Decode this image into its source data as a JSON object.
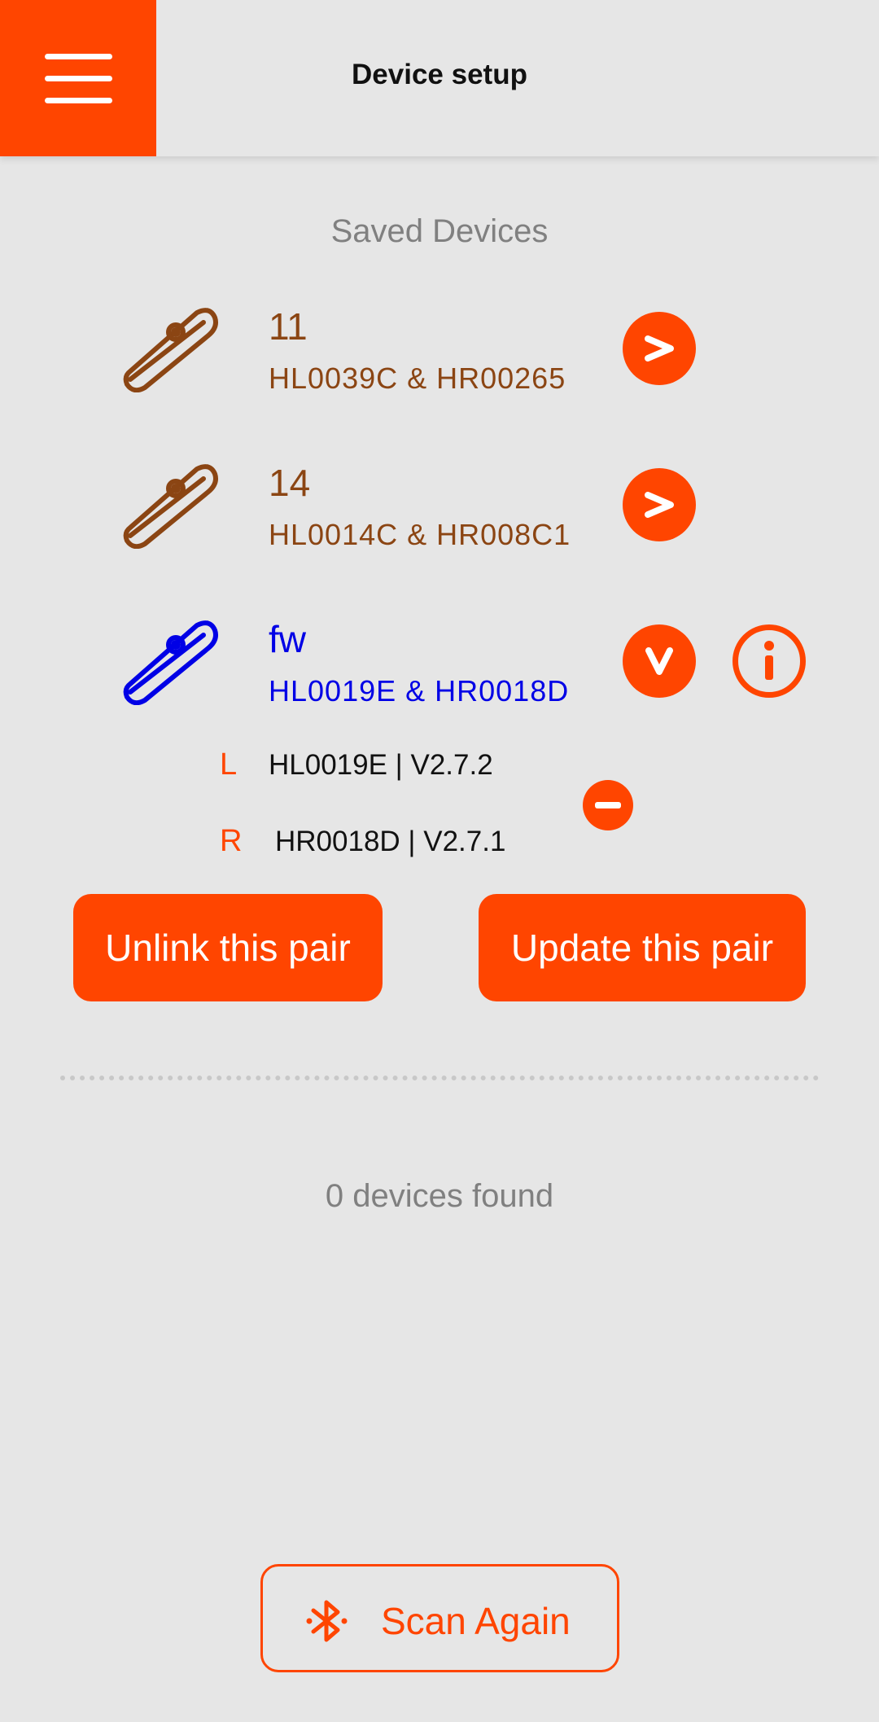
{
  "header": {
    "title": "Device setup",
    "menu_icon": "hamburger-menu-icon"
  },
  "saved": {
    "heading": "Saved Devices",
    "devices": [
      {
        "name": "11",
        "ids": "HL0039C & HR00265",
        "action_icon": "chevron-right-icon",
        "action_label": ">",
        "color": "#8b4513",
        "expanded": false
      },
      {
        "name": "14",
        "ids": "HL0014C & HR008C1",
        "action_icon": "chevron-right-icon",
        "action_label": ">",
        "color": "#8b4513",
        "expanded": false
      },
      {
        "name": "fw",
        "ids": "HL0019E & HR0018D",
        "action_icon": "chevron-down-icon",
        "action_label": "V",
        "color": "#0000e6",
        "expanded": true
      }
    ]
  },
  "expanded": {
    "left_letter": "L",
    "left_info": "HL0019E | V2.7.2",
    "right_letter": "R",
    "right_info": "HR0018D | V2.7.1",
    "remove_icon": "minus-circle-icon",
    "info_icon": "info-icon",
    "unlink_label": "Unlink this pair",
    "update_label": "Update this pair"
  },
  "scan": {
    "found_text": "0 devices found",
    "button_label": "Scan Again",
    "icon": "bluetooth-icon"
  },
  "colors": {
    "accent": "#ff4500",
    "brown": "#8b4513",
    "blue": "#0000e6",
    "background": "#e6e6e6"
  }
}
